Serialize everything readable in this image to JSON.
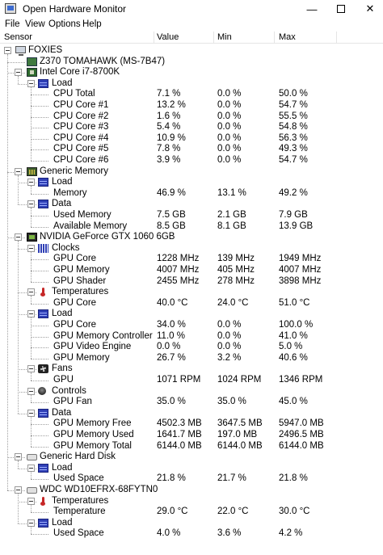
{
  "window": {
    "title": "Open Hardware Monitor",
    "min_glyph": "—",
    "close_glyph": "✕"
  },
  "menu": [
    "File",
    "View",
    "Options",
    "Help"
  ],
  "columns": {
    "sensor": "Sensor",
    "value": "Value",
    "min": "Min",
    "max": "Max"
  },
  "tree": [
    {
      "depth": 0,
      "toggle": true,
      "icon": "computer-icon",
      "name": "FOXIES",
      "value": "",
      "min": "",
      "max": ""
    },
    {
      "depth": 1,
      "toggle": false,
      "icon": "mainboard-icon",
      "name": "Z370 TOMAHAWK (MS-7B47)",
      "value": "",
      "min": "",
      "max": ""
    },
    {
      "depth": 1,
      "toggle": true,
      "icon": "cpu-icon",
      "name": "Intel Core i7-8700K",
      "value": "",
      "min": "",
      "max": ""
    },
    {
      "depth": 2,
      "toggle": true,
      "icon": "load-icon",
      "name": "Load",
      "value": "",
      "min": "",
      "max": ""
    },
    {
      "depth": 3,
      "toggle": false,
      "icon": "",
      "name": "CPU Total",
      "value": "7.1 %",
      "min": "0.0 %",
      "max": "50.0 %"
    },
    {
      "depth": 3,
      "toggle": false,
      "icon": "",
      "name": "CPU Core #1",
      "value": "13.2 %",
      "min": "0.0 %",
      "max": "54.7 %"
    },
    {
      "depth": 3,
      "toggle": false,
      "icon": "",
      "name": "CPU Core #2",
      "value": "1.6 %",
      "min": "0.0 %",
      "max": "55.5 %"
    },
    {
      "depth": 3,
      "toggle": false,
      "icon": "",
      "name": "CPU Core #3",
      "value": "5.4 %",
      "min": "0.0 %",
      "max": "54.8 %"
    },
    {
      "depth": 3,
      "toggle": false,
      "icon": "",
      "name": "CPU Core #4",
      "value": "10.9 %",
      "min": "0.0 %",
      "max": "56.3 %"
    },
    {
      "depth": 3,
      "toggle": false,
      "icon": "",
      "name": "CPU Core #5",
      "value": "7.8 %",
      "min": "0.0 %",
      "max": "49.3 %"
    },
    {
      "depth": 3,
      "toggle": false,
      "icon": "",
      "name": "CPU Core #6",
      "value": "3.9 %",
      "min": "0.0 %",
      "max": "54.7 %"
    },
    {
      "depth": 1,
      "toggle": true,
      "icon": "memory-icon",
      "name": "Generic Memory",
      "value": "",
      "min": "",
      "max": ""
    },
    {
      "depth": 2,
      "toggle": true,
      "icon": "load-icon",
      "name": "Load",
      "value": "",
      "min": "",
      "max": ""
    },
    {
      "depth": 3,
      "toggle": false,
      "icon": "",
      "name": "Memory",
      "value": "46.9 %",
      "min": "13.1 %",
      "max": "49.2 %"
    },
    {
      "depth": 2,
      "toggle": true,
      "icon": "data-icon",
      "name": "Data",
      "value": "",
      "min": "",
      "max": ""
    },
    {
      "depth": 3,
      "toggle": false,
      "icon": "",
      "name": "Used Memory",
      "value": "7.5 GB",
      "min": "2.1 GB",
      "max": "7.9 GB"
    },
    {
      "depth": 3,
      "toggle": false,
      "icon": "",
      "name": "Available Memory",
      "value": "8.5 GB",
      "min": "8.1 GB",
      "max": "13.9 GB"
    },
    {
      "depth": 1,
      "toggle": true,
      "icon": "gpu-icon",
      "name": "NVIDIA GeForce GTX 1060 6GB",
      "value": "",
      "min": "",
      "max": ""
    },
    {
      "depth": 2,
      "toggle": true,
      "icon": "clock-icon",
      "name": "Clocks",
      "value": "",
      "min": "",
      "max": ""
    },
    {
      "depth": 3,
      "toggle": false,
      "icon": "",
      "name": "GPU Core",
      "value": "1228 MHz",
      "min": "139 MHz",
      "max": "1949 MHz"
    },
    {
      "depth": 3,
      "toggle": false,
      "icon": "",
      "name": "GPU Memory",
      "value": "4007 MHz",
      "min": "405 MHz",
      "max": "4007 MHz"
    },
    {
      "depth": 3,
      "toggle": false,
      "icon": "",
      "name": "GPU Shader",
      "value": "2455 MHz",
      "min": "278 MHz",
      "max": "3898 MHz"
    },
    {
      "depth": 2,
      "toggle": true,
      "icon": "temperature-icon",
      "name": "Temperatures",
      "value": "",
      "min": "",
      "max": ""
    },
    {
      "depth": 3,
      "toggle": false,
      "icon": "",
      "name": "GPU Core",
      "value": "40.0 °C",
      "min": "24.0 °C",
      "max": "51.0 °C"
    },
    {
      "depth": 2,
      "toggle": true,
      "icon": "load-icon",
      "name": "Load",
      "value": "",
      "min": "",
      "max": ""
    },
    {
      "depth": 3,
      "toggle": false,
      "icon": "",
      "name": "GPU Core",
      "value": "34.0 %",
      "min": "0.0 %",
      "max": "100.0 %"
    },
    {
      "depth": 3,
      "toggle": false,
      "icon": "",
      "name": "GPU Memory Controller",
      "value": "11.0 %",
      "min": "0.0 %",
      "max": "41.0 %"
    },
    {
      "depth": 3,
      "toggle": false,
      "icon": "",
      "name": "GPU Video Engine",
      "value": "0.0 %",
      "min": "0.0 %",
      "max": "5.0 %"
    },
    {
      "depth": 3,
      "toggle": false,
      "icon": "",
      "name": "GPU Memory",
      "value": "26.7 %",
      "min": "3.2 %",
      "max": "40.6 %"
    },
    {
      "depth": 2,
      "toggle": true,
      "icon": "fan-icon",
      "name": "Fans",
      "value": "",
      "min": "",
      "max": ""
    },
    {
      "depth": 3,
      "toggle": false,
      "icon": "",
      "name": "GPU",
      "value": "1071 RPM",
      "min": "1024 RPM",
      "max": "1346 RPM"
    },
    {
      "depth": 2,
      "toggle": true,
      "icon": "control-icon",
      "name": "Controls",
      "value": "",
      "min": "",
      "max": ""
    },
    {
      "depth": 3,
      "toggle": false,
      "icon": "",
      "name": "GPU Fan",
      "value": "35.0 %",
      "min": "35.0 %",
      "max": "45.0 %"
    },
    {
      "depth": 2,
      "toggle": true,
      "icon": "data-icon",
      "name": "Data",
      "value": "",
      "min": "",
      "max": ""
    },
    {
      "depth": 3,
      "toggle": false,
      "icon": "",
      "name": "GPU Memory Free",
      "value": "4502.3 MB",
      "min": "3647.5 MB",
      "max": "5947.0 MB"
    },
    {
      "depth": 3,
      "toggle": false,
      "icon": "",
      "name": "GPU Memory Used",
      "value": "1641.7 MB",
      "min": "197.0 MB",
      "max": "2496.5 MB"
    },
    {
      "depth": 3,
      "toggle": false,
      "icon": "",
      "name": "GPU Memory Total",
      "value": "6144.0 MB",
      "min": "6144.0 MB",
      "max": "6144.0 MB"
    },
    {
      "depth": 1,
      "toggle": true,
      "icon": "hdd-icon",
      "name": "Generic Hard Disk",
      "value": "",
      "min": "",
      "max": ""
    },
    {
      "depth": 2,
      "toggle": true,
      "icon": "load-icon",
      "name": "Load",
      "value": "",
      "min": "",
      "max": ""
    },
    {
      "depth": 3,
      "toggle": false,
      "icon": "",
      "name": "Used Space",
      "value": "21.8 %",
      "min": "21.7 %",
      "max": "21.8 %"
    },
    {
      "depth": 1,
      "toggle": true,
      "icon": "hdd-icon",
      "name": "WDC WD10EFRX-68FYTN0",
      "value": "",
      "min": "",
      "max": ""
    },
    {
      "depth": 2,
      "toggle": true,
      "icon": "temperature-icon",
      "name": "Temperatures",
      "value": "",
      "min": "",
      "max": ""
    },
    {
      "depth": 3,
      "toggle": false,
      "icon": "",
      "name": "Temperature",
      "value": "29.0 °C",
      "min": "22.0 °C",
      "max": "30.0 °C"
    },
    {
      "depth": 2,
      "toggle": true,
      "icon": "load-icon",
      "name": "Load",
      "value": "",
      "min": "",
      "max": ""
    },
    {
      "depth": 3,
      "toggle": false,
      "icon": "",
      "name": "Used Space",
      "value": "4.0 %",
      "min": "3.6 %",
      "max": "4.2 %"
    }
  ]
}
